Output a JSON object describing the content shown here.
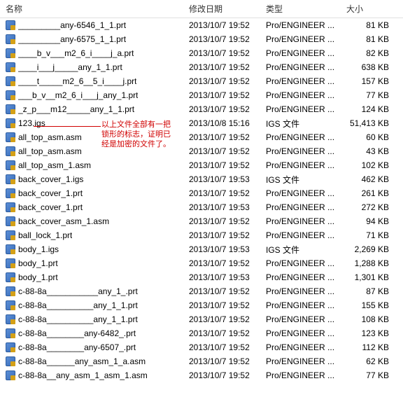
{
  "columns": {
    "name": "名称",
    "date": "修改日期",
    "type": "类型",
    "size": "大小"
  },
  "annotation": {
    "text": "以上文件全部有一把\n锁形的标志，证明已\n经是加密的文件了。"
  },
  "files": [
    {
      "name": "_________any-6546_1_1.prt",
      "date": "2013/10/7 19:52",
      "type": "Pro/ENGINEER ...",
      "size": "81 KB"
    },
    {
      "name": "_________any-6575_1_1.prt",
      "date": "2013/10/7 19:52",
      "type": "Pro/ENGINEER ...",
      "size": "81 KB"
    },
    {
      "name": "____b_v___m2_6_i____j_a.prt",
      "date": "2013/10/7 19:52",
      "type": "Pro/ENGINEER ...",
      "size": "82 KB"
    },
    {
      "name": "____i___j_____any_1_1.prt",
      "date": "2013/10/7 19:52",
      "type": "Pro/ENGINEER ...",
      "size": "638 KB"
    },
    {
      "name": "____t_____m2_6__5_i____j.prt",
      "date": "2013/10/7 19:52",
      "type": "Pro/ENGINEER ...",
      "size": "157 KB"
    },
    {
      "name": "___b_v__m2_6_i___j_any_1.prt",
      "date": "2013/10/7 19:52",
      "type": "Pro/ENGINEER ...",
      "size": "77 KB"
    },
    {
      "name": "_z_p___m12_____any_1_1.prt",
      "date": "2013/10/7 19:52",
      "type": "Pro/ENGINEER ...",
      "size": "124 KB"
    },
    {
      "name": "123.igs",
      "date": "2013/10/8 15:16",
      "type": "IGS 文件",
      "size": "51,413 KB"
    },
    {
      "name": "all_top_asm.asm",
      "date": "2013/10/7 19:52",
      "type": "Pro/ENGINEER ...",
      "size": "60 KB"
    },
    {
      "name": "all_top_asm.asm",
      "date": "2013/10/7 19:52",
      "type": "Pro/ENGINEER ...",
      "size": "43 KB"
    },
    {
      "name": "all_top_asm_1.asm",
      "date": "2013/10/7 19:52",
      "type": "Pro/ENGINEER ...",
      "size": "102 KB"
    },
    {
      "name": "back_cover_1.igs",
      "date": "2013/10/7 19:53",
      "type": "IGS 文件",
      "size": "462 KB"
    },
    {
      "name": "back_cover_1.prt",
      "date": "2013/10/7 19:52",
      "type": "Pro/ENGINEER ...",
      "size": "261 KB"
    },
    {
      "name": "back_cover_1.prt",
      "date": "2013/10/7 19:53",
      "type": "Pro/ENGINEER ...",
      "size": "272 KB"
    },
    {
      "name": "back_cover_asm_1.asm",
      "date": "2013/10/7 19:52",
      "type": "Pro/ENGINEER ...",
      "size": "94 KB"
    },
    {
      "name": "ball_lock_1.prt",
      "date": "2013/10/7 19:52",
      "type": "Pro/ENGINEER ...",
      "size": "71 KB"
    },
    {
      "name": "body_1.igs",
      "date": "2013/10/7 19:53",
      "type": "IGS 文件",
      "size": "2,269 KB"
    },
    {
      "name": "body_1.prt",
      "date": "2013/10/7 19:52",
      "type": "Pro/ENGINEER ...",
      "size": "1,288 KB"
    },
    {
      "name": "body_1.prt",
      "date": "2013/10/7 19:53",
      "type": "Pro/ENGINEER ...",
      "size": "1,301 KB"
    },
    {
      "name": "c-88-8a___________any_1_.prt",
      "date": "2013/10/7 19:52",
      "type": "Pro/ENGINEER ...",
      "size": "87 KB"
    },
    {
      "name": "c-88-8a__________any_1_1.prt",
      "date": "2013/10/7 19:52",
      "type": "Pro/ENGINEER ...",
      "size": "155 KB"
    },
    {
      "name": "c-88-8a__________any_1_1.prt",
      "date": "2013/10/7 19:52",
      "type": "Pro/ENGINEER ...",
      "size": "108 KB"
    },
    {
      "name": "c-88-8a________any-6482_.prt",
      "date": "2013/10/7 19:52",
      "type": "Pro/ENGINEER ...",
      "size": "123 KB"
    },
    {
      "name": "c-88-8a________any-6507_.prt",
      "date": "2013/10/7 19:52",
      "type": "Pro/ENGINEER ...",
      "size": "112 KB"
    },
    {
      "name": "c-88-8a______any_asm_1_a.asm",
      "date": "2013/10/7 19:52",
      "type": "Pro/ENGINEER ...",
      "size": "62 KB"
    },
    {
      "name": "c-88-8a__any_asm_1_asm_1.asm",
      "date": "2013/10/7 19:52",
      "type": "Pro/ENGINEER ...",
      "size": "77 KB"
    }
  ]
}
